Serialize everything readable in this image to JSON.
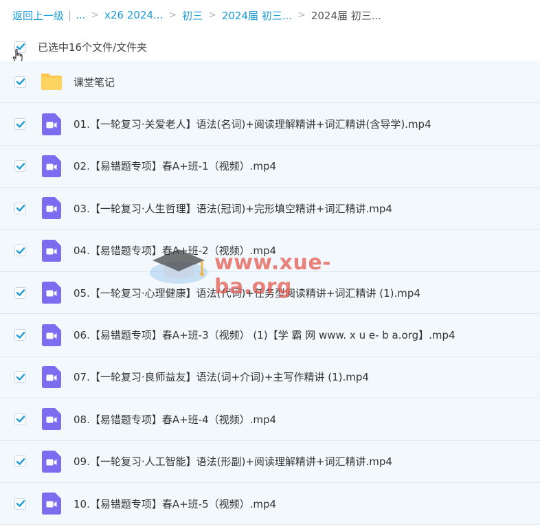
{
  "breadcrumb": {
    "back": "返回上一级",
    "ellipsis": "...",
    "items": [
      "x26 2024...",
      "初三",
      "2024届 初三..."
    ],
    "current": "2024届 初三..."
  },
  "selection": {
    "text": "已选中16个文件/文件夹",
    "checked": true
  },
  "files": [
    {
      "name": "课堂笔记",
      "type": "folder"
    },
    {
      "name": "01.【一轮复习·关爱老人】语法(名词)+阅读理解精讲+词汇精讲(含导学).mp4",
      "type": "video"
    },
    {
      "name": "02.【易错题专项】春A+班-1（视频）.mp4",
      "type": "video"
    },
    {
      "name": "03.【一轮复习·人生哲理】语法(冠词)+完形填空精讲+词汇精讲.mp4",
      "type": "video"
    },
    {
      "name": "04.【易错题专项】春A+班-2（视频）.mp4",
      "type": "video"
    },
    {
      "name": "05.【一轮复习·心理健康】语法(代词)+任务型阅读精讲+词汇精讲 (1).mp4",
      "type": "video"
    },
    {
      "name": "06.【易错题专项】春A+班-3（视频） (1)【学 霸 网 www. x u e- b a.org】.mp4",
      "type": "video"
    },
    {
      "name": "07.【一轮复习·良师益友】语法(词+介词)+主写作精讲 (1).mp4",
      "type": "video"
    },
    {
      "name": "08.【易错题专项】春A+班-4（视频）.mp4",
      "type": "video"
    },
    {
      "name": "09.【一轮复习·人工智能】语法(形副)+阅读理解精讲+词汇精讲.mp4",
      "type": "video"
    },
    {
      "name": "10.【易错题专项】春A+班-5（视频）.mp4",
      "type": "video"
    }
  ],
  "watermark": {
    "text": "www.xue-ba.org"
  },
  "colors": {
    "link": "#1a9bd7",
    "check": "#1a9bd7",
    "row_bg": "#f3f8fc",
    "folder": "#fcc74a",
    "video": "#7b6cf0"
  }
}
